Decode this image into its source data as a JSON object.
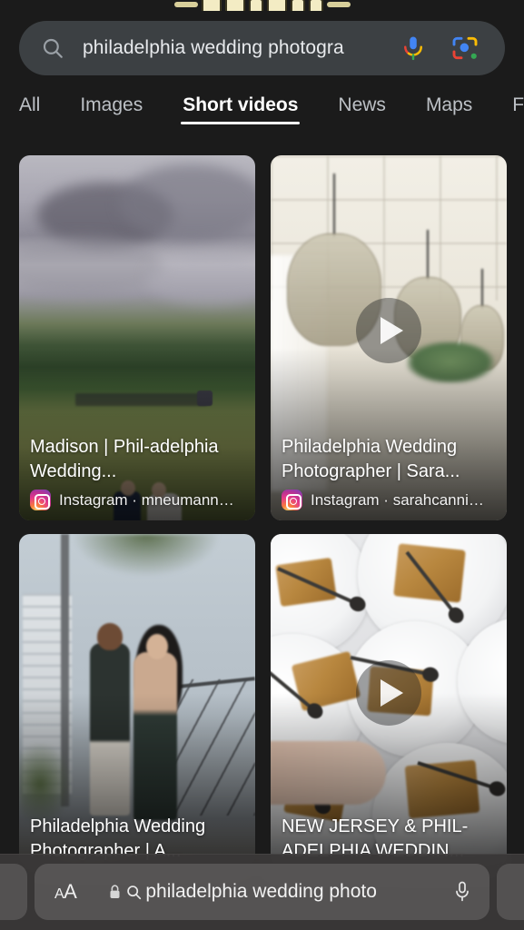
{
  "browser": {
    "url_text": "philadelphia wedding photo",
    "aa_label_small": "A",
    "aa_label_big": "A",
    "lock_icon": "lock-icon",
    "search_icon": "search-icon",
    "mic_icon": "microphone-icon",
    "left_tab_peek": "tab-peek-left",
    "right_tab_peek": "tab-peek-right"
  },
  "logo": {
    "name": "google-doodle",
    "alt": "Google"
  },
  "search": {
    "query": "philadelphia wedding photogra",
    "search_icon": "search-icon",
    "mic_icon": "google-mic-icon",
    "lens_icon": "google-lens-icon"
  },
  "tabs": [
    {
      "label": "All",
      "active": false
    },
    {
      "label": "Images",
      "active": false
    },
    {
      "label": "Short videos",
      "active": true
    },
    {
      "label": "News",
      "active": false
    },
    {
      "label": "Maps",
      "active": false
    },
    {
      "label": "Forum",
      "active": false
    }
  ],
  "results": [
    {
      "title": "Madison | Phil-adelphia Wedding...",
      "source": "Instagram",
      "separator": "·",
      "channel": "mneumann…",
      "source_line": "Instagram · mneumann…",
      "source_icon": "instagram-icon",
      "has_play_button": false,
      "overlay_text": ""
    },
    {
      "title": "Philadelphia Wedding Photographer | Sara...",
      "source": "Instagram",
      "separator": "·",
      "channel": "sarahcanni…",
      "source_line": "Instagram · sarahcanni…",
      "source_icon": "instagram-icon",
      "has_play_button": true,
      "overlay_text": ""
    },
    {
      "title": "Philadelphia Wedding Photographer | A...",
      "source": "",
      "separator": "",
      "channel": "",
      "source_line": "",
      "source_icon": "",
      "has_play_button": false,
      "overlay_text": ""
    },
    {
      "title": "NEW JERSEY & PHIL-ADELPHIA WEDDIN...",
      "source": "",
      "separator": "",
      "channel": "",
      "source_line": "",
      "source_icon": "",
      "has_play_button": true,
      "overlay_text": ""
    }
  ],
  "colors": {
    "page_background": "#1b1b1b",
    "searchbar_background": "#3c4043",
    "text_primary": "#ffffff",
    "text_secondary": "#bdc1c6",
    "google_blue": "#4285f4",
    "google_red": "#ea4335",
    "google_yellow": "#fbbc05",
    "google_green": "#34a853"
  }
}
